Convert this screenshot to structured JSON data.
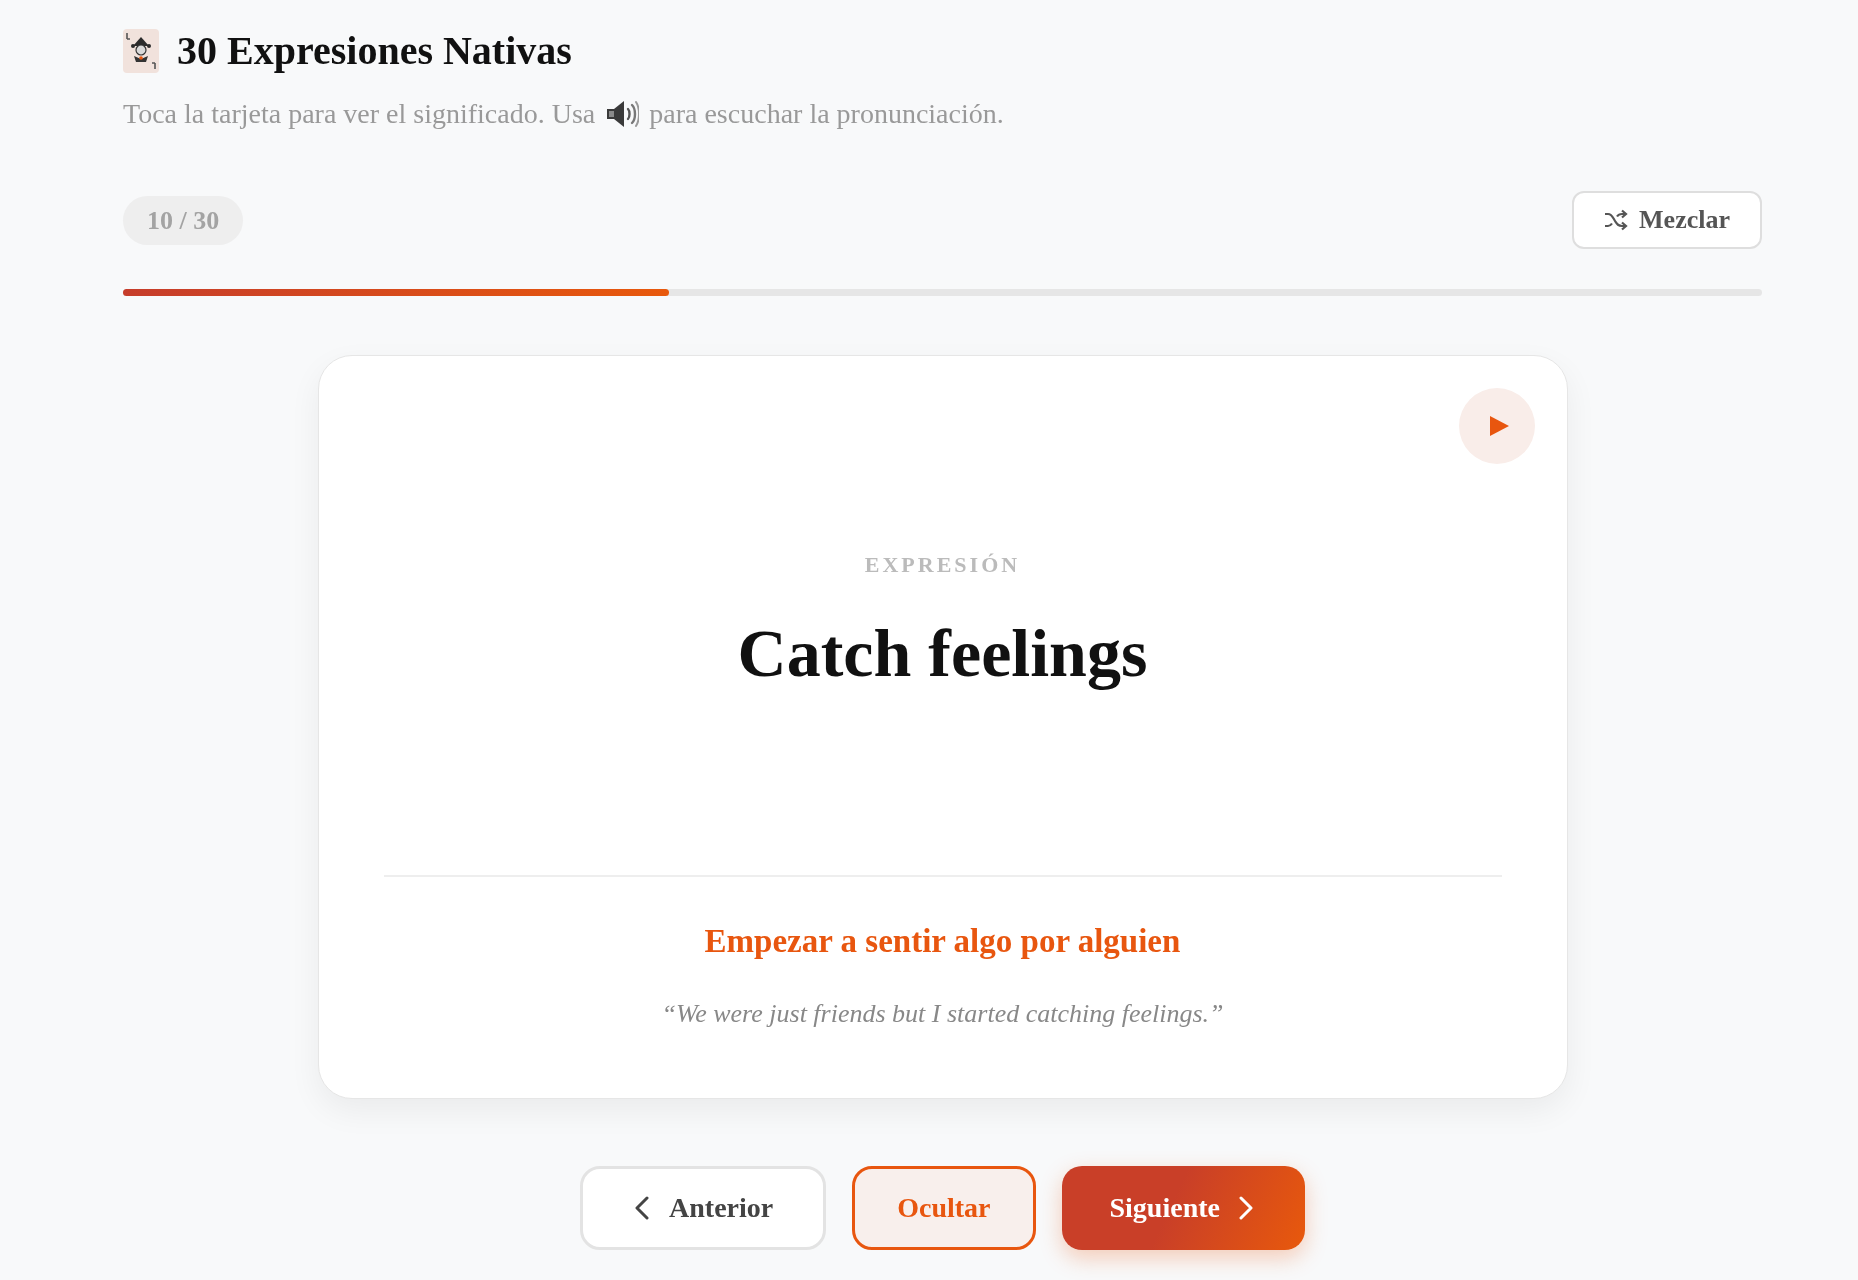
{
  "header": {
    "title": "30 Expresiones Nativas",
    "subtitle_before_icon": "Toca la tarjeta para ver el significado. Usa",
    "subtitle_after_icon": "para escuchar la pronunciación."
  },
  "progress": {
    "counter": "10 / 30",
    "level": 0.333
  },
  "shuffle_button": {
    "label": "Mezclar"
  },
  "card": {
    "label": "EXPRESIÓN",
    "phrase": "Catch feelings",
    "revealed": true,
    "meaning": "Empezar a sentir algo por alguien",
    "example": "“We were just friends but I started catching feelings.”"
  },
  "nav_buttons": [
    {
      "label": "Anterior",
      "kind": "previous"
    },
    {
      "label": "Ocultar",
      "kind": "toggle"
    },
    {
      "label": "Siguiente",
      "kind": "next"
    }
  ]
}
